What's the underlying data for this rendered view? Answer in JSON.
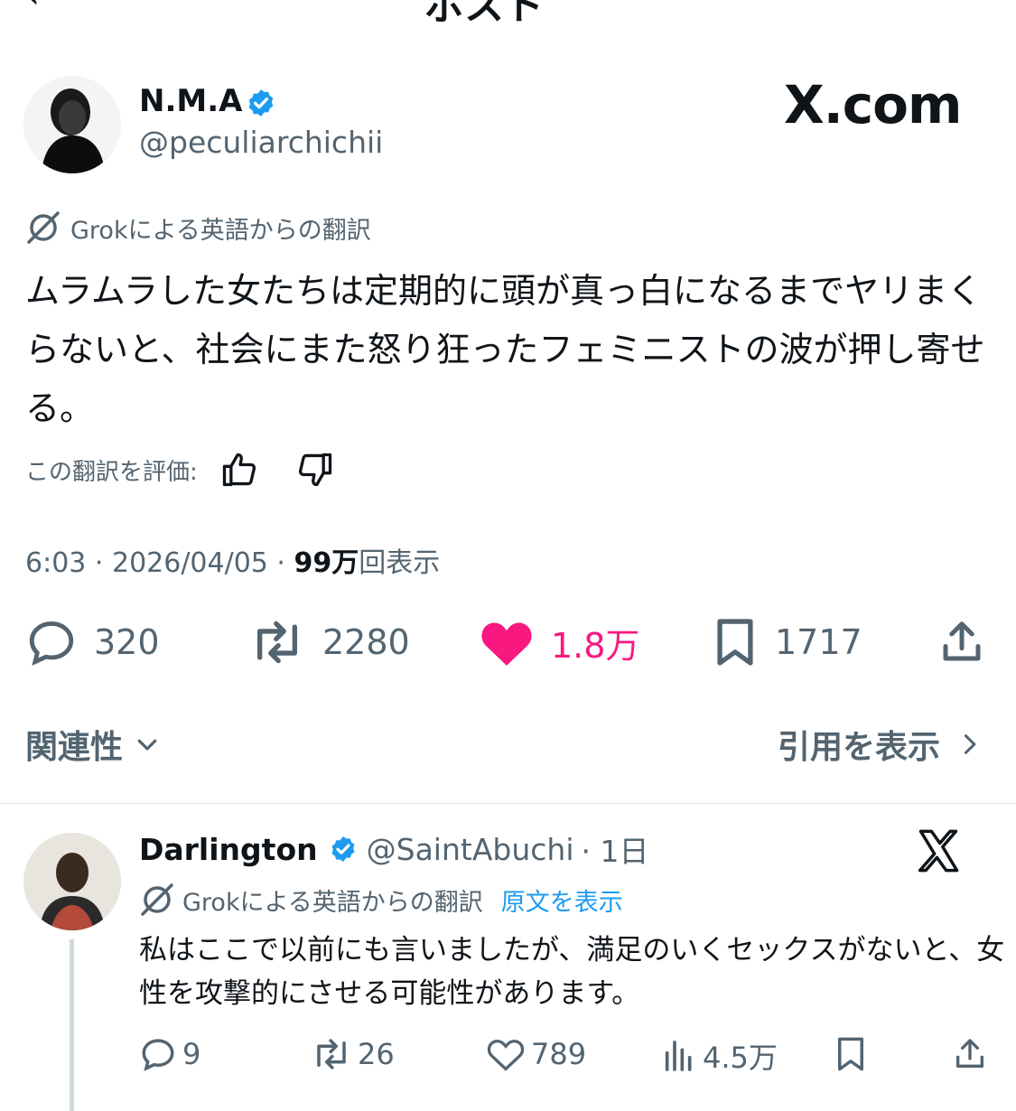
{
  "header": {
    "back_icon": "chevron-left-icon",
    "title": "ポスト"
  },
  "post": {
    "display_name": "N.M.A",
    "handle": "@peculiarchichii",
    "watermark": "X.com",
    "translation_label": "Grokによる英語からの翻訳",
    "text": "ムラムラした女たちは定期的に頭が真っ白になるまでヤリまくらないと、社会にまた怒り狂ったフェミニストの波が押し寄せる。",
    "rate_label": "この翻訳を評価:",
    "time": "6:03 · 2026/04/05 · ",
    "views_count": "99万",
    "views_label": "回表示",
    "replies": "320",
    "reposts": "2280",
    "likes": "1.8万",
    "bookmarks": "1717",
    "like_color": "#f91880",
    "verified_color": "#1d9bf0"
  },
  "filters": {
    "sort_label": "関連性",
    "quotes_label": "引用を表示"
  },
  "reply": {
    "display_name": "Darlington",
    "handle": "@SaintAbuchi",
    "time": "· 1日",
    "translation_label": "Grokによる英語からの翻訳",
    "show_original": "原文を表示",
    "text": "私はここで以前にも言いましたが、満足のいくセックスがないと、女性を攻撃的にさせる可能性があります。",
    "replies": "9",
    "reposts": "26",
    "likes": "789",
    "views": "4.5万"
  }
}
